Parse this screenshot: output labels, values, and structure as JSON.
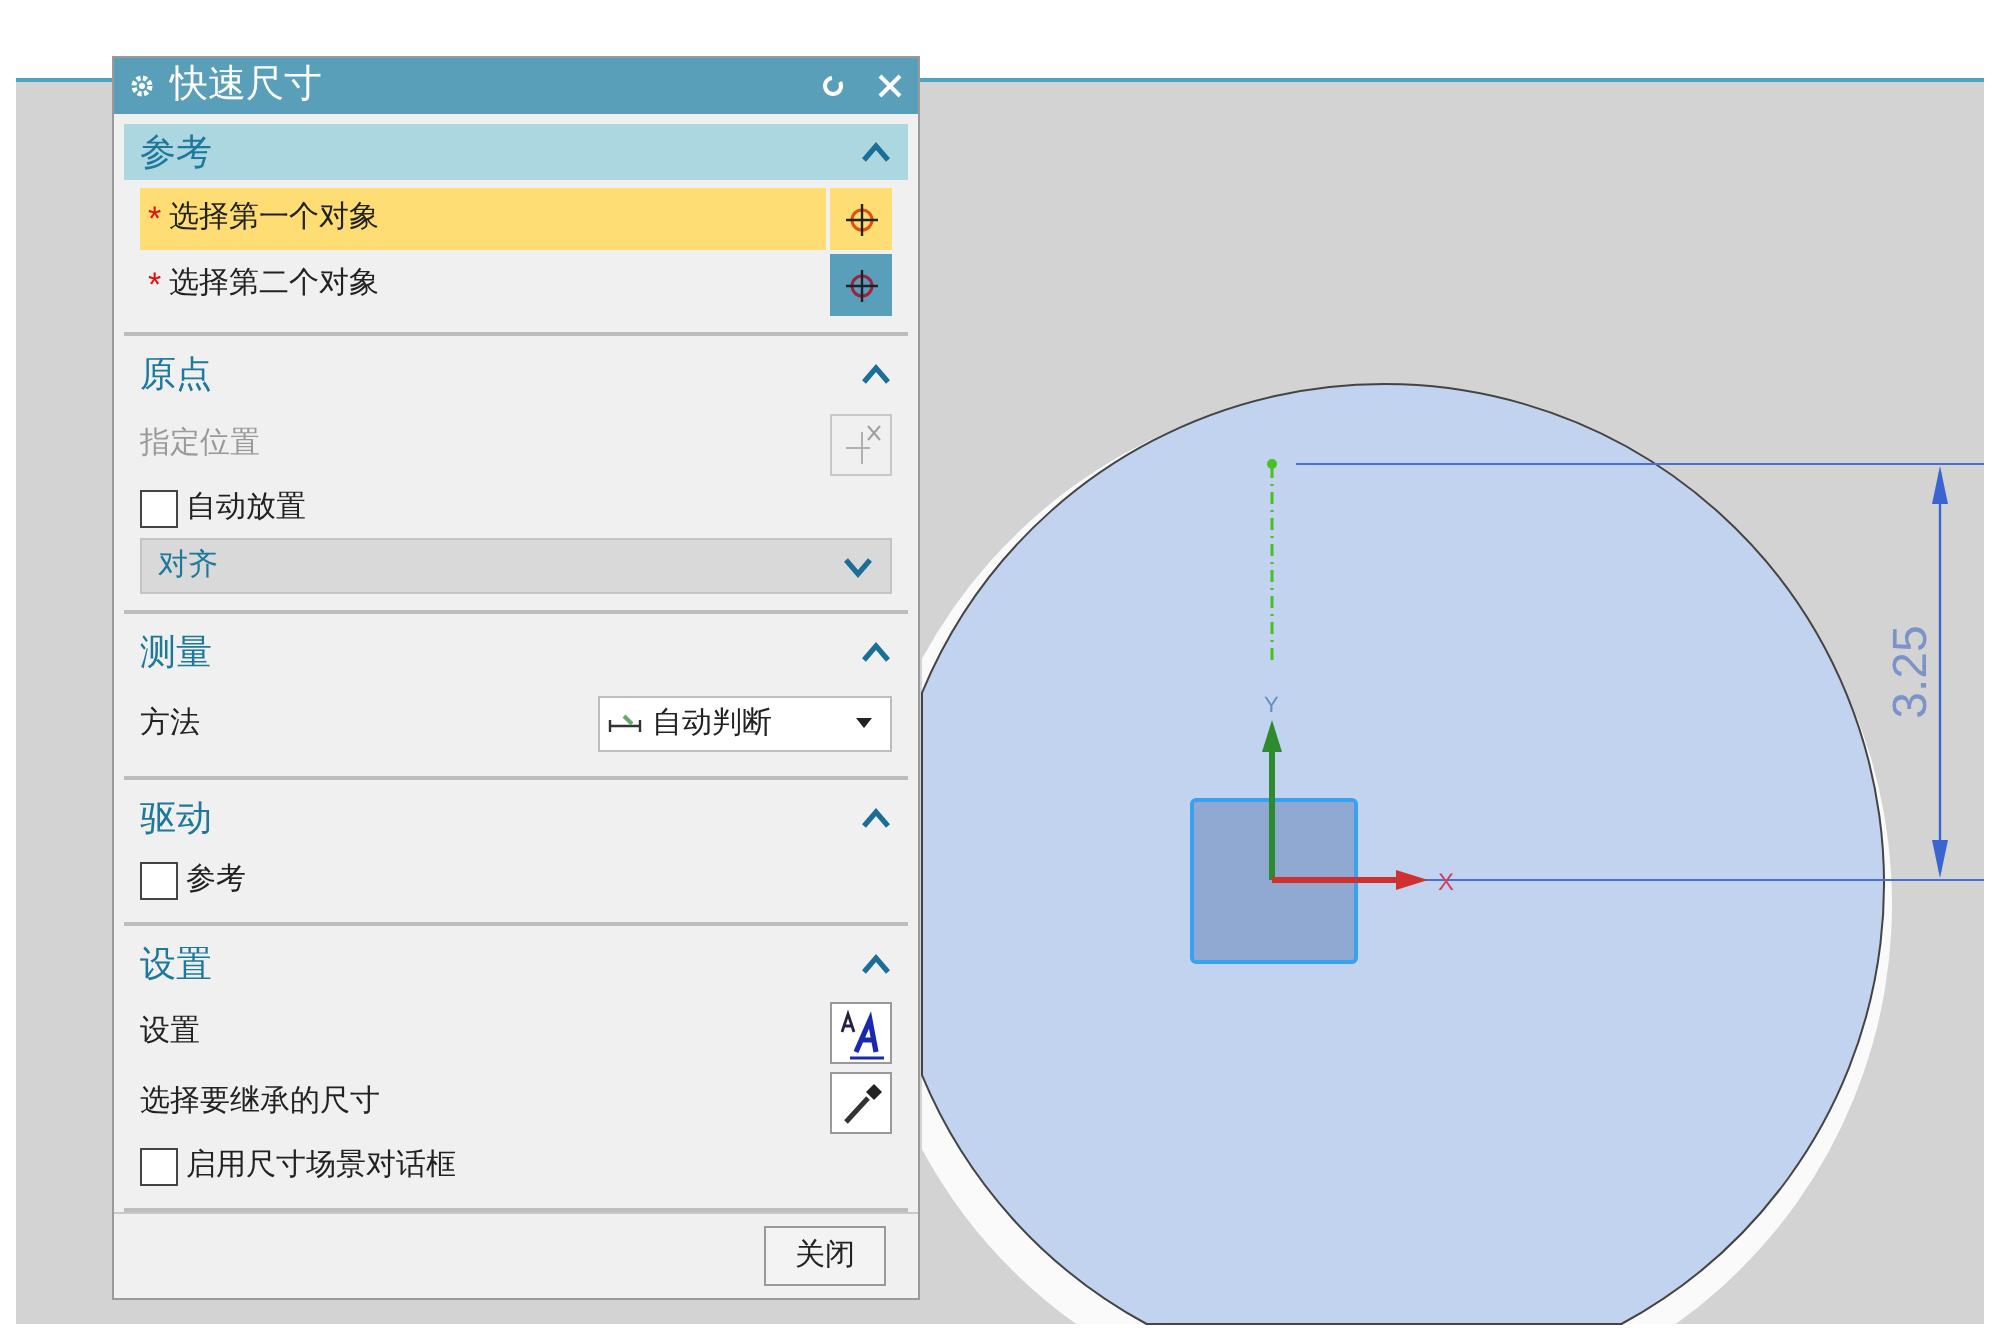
{
  "dialog": {
    "title": "快速尺寸",
    "sections": [
      {
        "title": "参考",
        "expanded": true,
        "highlighted": true,
        "rows": [
          {
            "kind": "selection",
            "required_mark": "*",
            "label": "选择第一个对象",
            "selected": true
          },
          {
            "kind": "selection",
            "required_mark": "*",
            "label": "选择第二个对象",
            "selected": false
          }
        ]
      },
      {
        "title": "原点",
        "expanded": true,
        "highlighted": false,
        "rows": [
          {
            "kind": "location",
            "label": "指定位置",
            "disabled": true
          },
          {
            "kind": "checkbox",
            "label": "自动放置",
            "checked": false
          },
          {
            "kind": "dropdown",
            "value": "对齐"
          }
        ]
      },
      {
        "title": "测量",
        "expanded": true,
        "highlighted": false,
        "rows": [
          {
            "kind": "labeled_dropdown",
            "label": "方法",
            "value": "自动判断"
          }
        ]
      },
      {
        "title": "驱动",
        "expanded": true,
        "highlighted": false,
        "rows": [
          {
            "kind": "checkbox",
            "label": "参考",
            "checked": false
          }
        ]
      },
      {
        "title": "设置",
        "expanded": true,
        "highlighted": false,
        "rows": [
          {
            "kind": "style_button",
            "label": "设置"
          },
          {
            "kind": "picker_button",
            "label": "选择要继承的尺寸"
          },
          {
            "kind": "checkbox",
            "label": "启用尺寸场景对话框",
            "checked": false
          }
        ]
      }
    ],
    "close_button": "关闭"
  },
  "viewport": {
    "dimension": "3.25",
    "x_axis": "X",
    "y_axis": "Y"
  }
}
